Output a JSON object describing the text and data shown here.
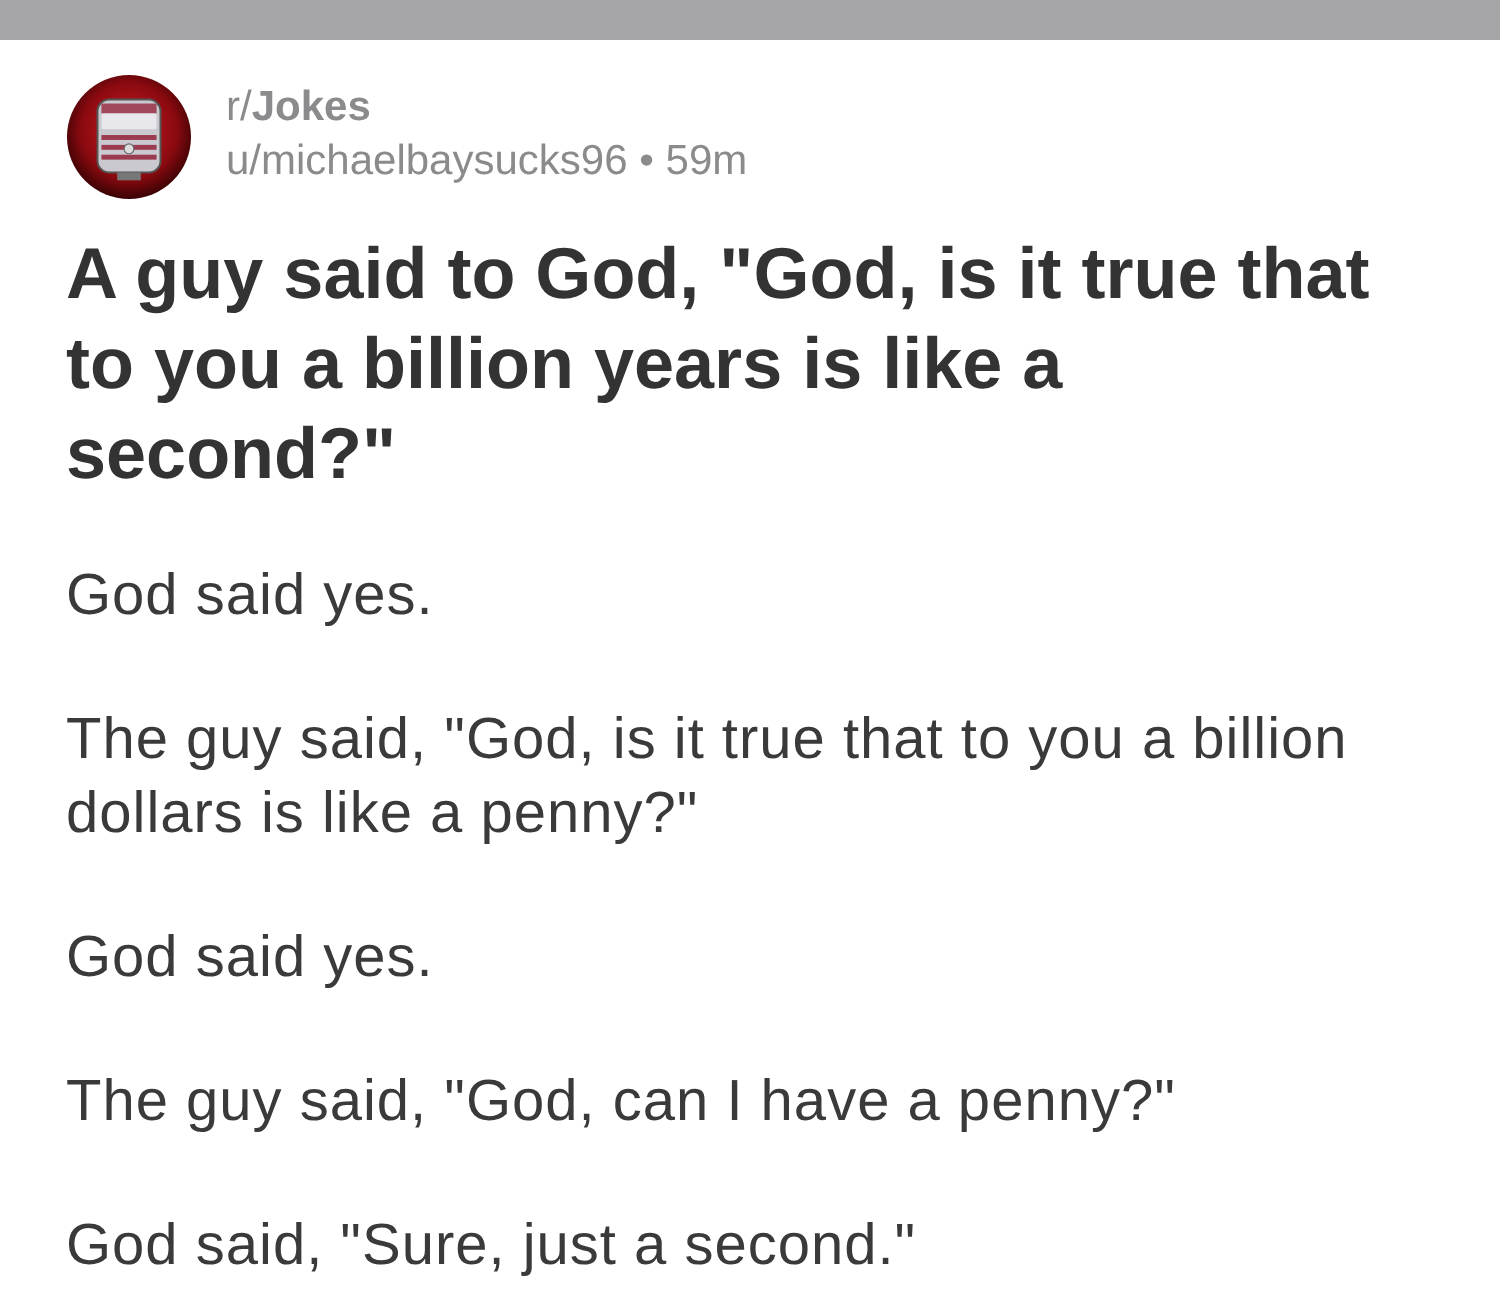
{
  "post": {
    "subreddit": "r/**Jokes**",
    "byline": "u/michaelbaysucks96 • 59m",
    "title": "A guy said to God, \"God, is it true that to you a billion years is like a second?\"",
    "body": [
      "God said yes.",
      "The guy said, \"God, is it true that to you a billion dollars is like a penny?\"",
      "God said yes.",
      "The guy said, \"God, can I have a penny?\"",
      "God said, \"Sure, just a second.\""
    ]
  }
}
